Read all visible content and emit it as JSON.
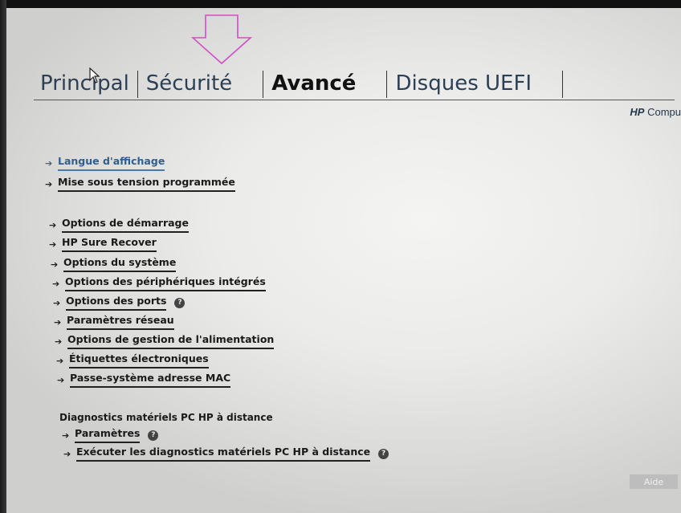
{
  "tabs": [
    {
      "label": "Principal"
    },
    {
      "label": "Sécurité"
    },
    {
      "label": "Avancé"
    },
    {
      "label": "Disques UEFI"
    }
  ],
  "brand": {
    "bold": "HP",
    "text": "Compu"
  },
  "menu_group1": [
    {
      "label": "Langue d'affichage"
    },
    {
      "label": "Mise sous tension programmée"
    }
  ],
  "menu_group2": [
    {
      "label": "Options de démarrage"
    },
    {
      "label": "HP Sure Recover"
    },
    {
      "label": "Options du système"
    },
    {
      "label": "Options des périphériques intégrés"
    },
    {
      "label": "Options des ports"
    },
    {
      "label": "Paramètres réseau"
    },
    {
      "label": "Options de gestion de l'alimentation"
    },
    {
      "label": "Étiquettes électroniques"
    },
    {
      "label": "Passe-système adresse MAC"
    }
  ],
  "diagnostics": {
    "title": "Diagnostics matériels PC HP à distance",
    "items": [
      {
        "label": "Paramètres"
      },
      {
        "label": "Exécuter les diagnostics matériels PC HP à distance"
      }
    ]
  },
  "footer": {
    "help_label": "Aide"
  },
  "icons": {
    "arrow": "arrow-right-icon",
    "help": "question-circle-icon",
    "annotation": "down-arrow-outline-icon"
  },
  "colors": {
    "selected": "#2f5f8e",
    "annotation": "#d04fc6"
  }
}
